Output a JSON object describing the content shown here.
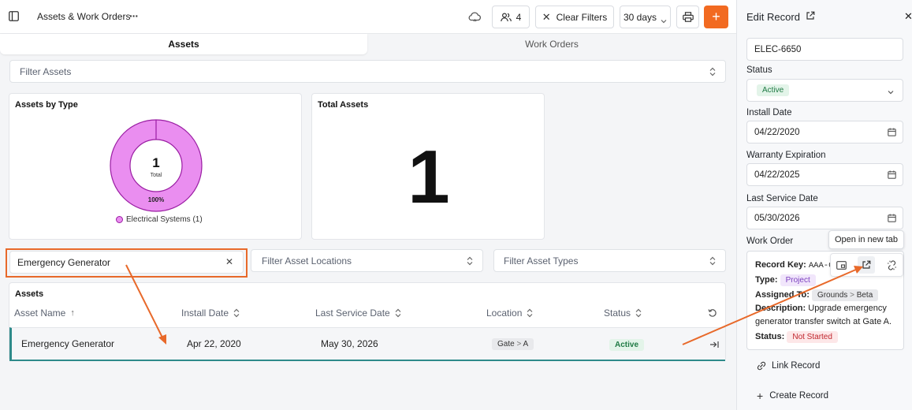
{
  "app": {
    "title": "Assets & Work Orders"
  },
  "toolbar": {
    "users_count": "4",
    "clear_filters": "Clear Filters",
    "range": "30 days"
  },
  "tabs": [
    {
      "label": "Assets",
      "active": true
    },
    {
      "label": "Work Orders",
      "active": false
    }
  ],
  "filters": {
    "assets_placeholder": "Filter Assets",
    "search_value": "Emergency Generator",
    "locations_placeholder": "Filter Asset Locations",
    "types_placeholder": "Filter Asset Types"
  },
  "assets_by_type": {
    "title": "Assets by Type",
    "center_value": "1",
    "center_label": "Total",
    "percent_label": "100%",
    "legend": "Electrical Systems (1)",
    "color": "#ea8ef0"
  },
  "chart_data": {
    "type": "pie",
    "title": "Assets by Type",
    "categories": [
      "Electrical Systems"
    ],
    "values": [
      1
    ],
    "percent": [
      100
    ]
  },
  "total_assets": {
    "title": "Total Assets",
    "value": "1"
  },
  "table": {
    "title": "Assets",
    "columns": [
      "Asset Name",
      "Install Date",
      "Last Service Date",
      "Location",
      "Status"
    ],
    "rows": [
      {
        "name": "Emergency Generator",
        "install_date": "Apr 22, 2020",
        "last_service": "May 30, 2026",
        "location": [
          "Gate",
          "A"
        ],
        "status": "Active"
      }
    ]
  },
  "panel": {
    "title": "Edit Record",
    "record_id": "ELEC-6650",
    "status_label": "Status",
    "status_value": "Active",
    "install_label": "Install Date",
    "install_value": "04/22/2020",
    "warranty_label": "Warranty Expiration",
    "warranty_value": "04/22/2025",
    "service_label": "Last Service Date",
    "service_value": "05/30/2026",
    "work_order_label": "Work Order",
    "tooltip": "Open in new tab",
    "work_order": {
      "record_key_label": "Record Key:",
      "record_key": "AAA-01",
      "type_label": "Type:",
      "type_value": "Project",
      "assigned_label": "Assigned To:",
      "assigned_value": [
        "Grounds",
        "Beta"
      ],
      "description_label": "Description:",
      "description_line1": "Upgrade emergency",
      "description_line2": "generator transfer switch at Gate A.",
      "status_label": "Status:",
      "status_value": "Not Started"
    },
    "link_record": "Link Record",
    "create_record": "Create Record"
  },
  "colors": {
    "accent": "#f26a21",
    "active_green": "#1f7a44",
    "active_bg": "#e3f4e9",
    "project_purple": "#7b3fbf",
    "not_started_red": "#c0262d"
  }
}
